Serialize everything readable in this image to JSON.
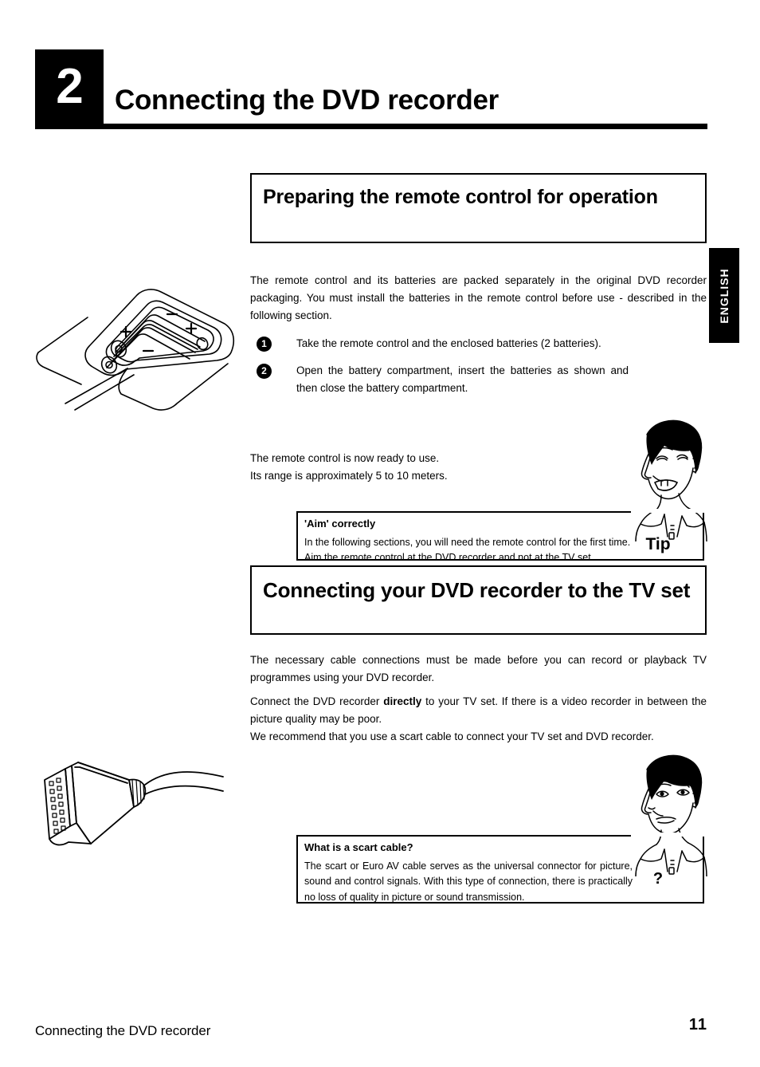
{
  "chapter": {
    "number": "2",
    "title": "Connecting the DVD recorder"
  },
  "language_tab": {
    "label": "ENGLISH"
  },
  "sections": {
    "remote": {
      "heading": "Preparing the remote control for operation",
      "intro": "The remote control and its batteries are packed separately in the original DVD recorder packaging. You must install the batteries in the remote control before use - described in the following section.",
      "steps": [
        {
          "number": "1",
          "text": "Take the remote control and the enclosed batteries (2 batteries)."
        },
        {
          "number": "2",
          "text": "Open the battery compartment, insert the batteries as shown and then close the battery compartment."
        }
      ],
      "ready_line_1": "The remote control is now ready to use.",
      "ready_line_2": "Its range is approximately 5 to 10 meters."
    },
    "tvset": {
      "heading": "Connecting your DVD recorder to the TV set",
      "paragraph_1": "The necessary cable connections must be made before you can record or playback TV programmes using your DVD recorder.",
      "paragraph_2_part1": "Connect the DVD recorder ",
      "paragraph_2_bold": "directly",
      "paragraph_2_part2": " to your TV set. If there is a video recorder in between the picture quality may be poor.",
      "paragraph_3": "We recommend that you use a scart cable to connect your TV set and DVD recorder."
    }
  },
  "callouts": {
    "tip": {
      "tag": "Tip",
      "title": "'Aim' correctly",
      "body_line_1": "In the following sections, you will need the remote control for the first time.",
      "body_line_2": "Aim the remote control at the DVD recorder and not at the TV set."
    },
    "question": {
      "tag": "?",
      "title": "What is a scart cable?",
      "body": "The scart or Euro AV cable serves as the universal connector for picture, sound and control signals. With this type of connection, there is practically no loss of quality in picture or sound transmission."
    }
  },
  "illustrations": {
    "remote_battery": "remote-control-battery-compartment-illustration",
    "scart_cable": "scart-cable-connector-illustration",
    "tip_face": "smiling-man-cartoon-illustration",
    "question_face": "puzzled-man-cartoon-illustration",
    "battery_polarity": [
      "+",
      "-",
      "+",
      "-"
    ]
  },
  "footer": {
    "section_label": "Connecting the DVD recorder",
    "page_number": "11"
  },
  "colors": {
    "ink": "#000000",
    "paper": "#ffffff"
  }
}
